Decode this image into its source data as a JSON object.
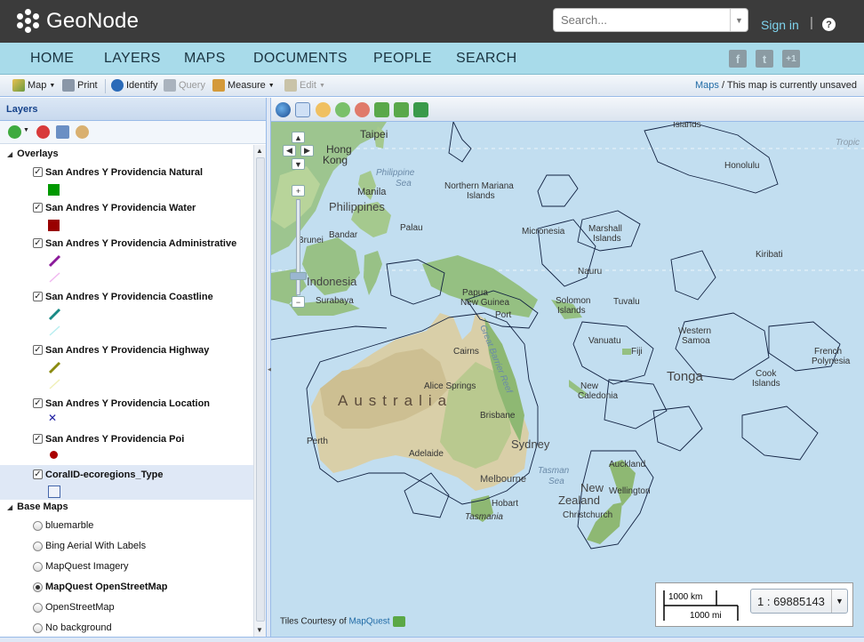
{
  "header": {
    "brand": "GeoNode",
    "search_placeholder": "Search...",
    "signin": "Sign in",
    "separator": "|",
    "help": "?"
  },
  "nav": {
    "items": [
      "HOME",
      "LAYERS",
      "MAPS",
      "DOCUMENTS",
      "PEOPLE",
      "SEARCH"
    ],
    "social": [
      "f",
      "t",
      "+1"
    ]
  },
  "toolbar": {
    "map": "Map",
    "print": "Print",
    "identify": "Identify",
    "query": "Query",
    "measure": "Measure",
    "edit": "Edit",
    "status_link": "Maps",
    "status_text": " / This map is currently unsaved"
  },
  "layers_panel": {
    "title": "Layers",
    "overlays_title": "Overlays",
    "overlays": [
      {
        "name": "San Andres Y Providencia Natural",
        "legend": "fill",
        "color": "#009900"
      },
      {
        "name": "San Andres Y Providencia Water",
        "legend": "fill",
        "color": "#990000"
      },
      {
        "name": "San Andres Y Providencia Administrative",
        "legend": "line",
        "color": "#8b1a9a",
        "color2": "#f0b8f0"
      },
      {
        "name": "San Andres Y Providencia Coastline",
        "legend": "line",
        "color": "#1a8a86",
        "color2": "#b8eef0"
      },
      {
        "name": "San Andres Y Providencia Highway",
        "legend": "line",
        "color": "#8a8a10",
        "color2": "#f0f0b8"
      },
      {
        "name": "San Andres Y Providencia Location",
        "legend": "cross",
        "color": "#1a1aa0"
      },
      {
        "name": "San Andres Y Providencia Poi",
        "legend": "dot",
        "color": "#aa0000"
      },
      {
        "name": "CoralID-ecoregions_Type",
        "legend": "square",
        "color": "#4466aa",
        "selected": true
      }
    ],
    "base_title": "Base Maps",
    "base_maps": [
      {
        "name": "bluemarble",
        "on": false
      },
      {
        "name": "Bing Aerial With Labels",
        "on": false
      },
      {
        "name": "MapQuest Imagery",
        "on": false
      },
      {
        "name": "MapQuest OpenStreetMap",
        "on": true
      },
      {
        "name": "OpenStreetMap",
        "on": false
      },
      {
        "name": "No background",
        "on": false
      }
    ]
  },
  "map": {
    "labels": {
      "taipei": "Taipei",
      "hong_kong": "Hong\nKong",
      "philippine_sea": "Philippine\nSea",
      "manila": "Manila",
      "philippines": "Philippines",
      "northern_mariana": "Northern Mariana\nIslands",
      "palau": "Palau",
      "micronesia": "Micronesia",
      "marshall": "Marshall\nIslands",
      "honolulu": "Honolulu",
      "islands": "Islands",
      "kiribati": "Kiribati",
      "nauru": "Nauru",
      "brunei": "Brunei",
      "bandar": "Bandar",
      "indonesia": "Indonesia",
      "surabaya": "Surabaya",
      "papua": "Papua\nNew Guinea",
      "port": "Port",
      "solomon": "Solomon\nIslands",
      "tuvalu": "Tuvalu",
      "western_samoa": "Western\nSamoa",
      "vanuatu": "Vanuatu",
      "fiji": "Fiji",
      "tonga": "Tonga",
      "cook": "Cook\nIslands",
      "french_polynesia": "French\nPolynesia",
      "new_caledonia": "New\nCaledonia",
      "cairns": "Cairns",
      "great_barrier": "Great Barrier Reef",
      "australia": "Australia",
      "alice_springs": "Alice Springs",
      "brisbane": "Brisbane",
      "perth": "Perth",
      "adelaide": "Adelaide",
      "sydney": "Sydney",
      "melbourne": "Melbourne",
      "tasman_sea": "Tasman\nSea",
      "hobart": "Hobart",
      "tasmania": "Tasmania",
      "new_zealand": "New\nZealand",
      "auckland": "Auckland",
      "wellington": "Wellington",
      "christchurch": "Christchurch",
      "tropic": "Tropic"
    },
    "scale_km": "1000 km",
    "scale_mi": "1000 mi",
    "scale_ratio": "1 : 69885143",
    "attribution_text": "Tiles Courtesy of ",
    "attribution_link": "MapQuest"
  }
}
